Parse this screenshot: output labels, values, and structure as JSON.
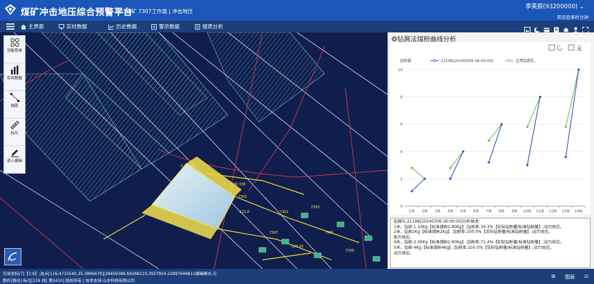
{
  "header": {
    "title": "煤矿冲击地压综合预警平台",
    "mine_info": "唐口煤矿 7307工作面 | 冲击地压",
    "user_name": "李英辰(93200000)",
    "user_sub": "距后登录时分钟",
    "logo_icon": "mine-logo-icon"
  },
  "nav": {
    "items": [
      {
        "label": "主界面",
        "icon": "home-icon"
      },
      {
        "label": "实时数据",
        "icon": "monitor-icon"
      },
      {
        "label": "历史数据",
        "icon": "history-chart-icon"
      },
      {
        "label": "警示数据",
        "icon": "warning-data-icon"
      },
      {
        "label": "报表分析",
        "icon": "report-icon"
      }
    ],
    "right_icons": [
      "image-icon",
      "moon-icon",
      "card-icon",
      "list-icon",
      "bell-icon",
      "person-icon",
      "expand-icon"
    ]
  },
  "map": {
    "tools": [
      {
        "label": "功能菜单",
        "icon": "function-menu-icon"
      },
      {
        "label": "实时数据",
        "icon": "bar-chart-icon"
      },
      {
        "label": "抽层",
        "icon": "layer-icon"
      },
      {
        "label": "标尺",
        "icon": "ruler-icon"
      },
      {
        "label": "进入编辑",
        "icon": "edit-icon"
      }
    ],
    "widget_icon": "map-widget-icon",
    "labels": [
      "7301",
      "7302",
      "-130.338",
      "7303",
      "7305",
      "-121.8",
      "-123.43",
      "7307",
      "-2.4:-96",
      "7309"
    ]
  },
  "panel": {
    "title": "❂钻屑法煤粉曲线分析",
    "toolbar_icons": [
      "restore-icon",
      "refresh-icon",
      "save-icon",
      "download-icon"
    ],
    "analysis": {
      "heading": "钻屑孔,21198[20240306 06:00:00]分析描述:",
      "lines": [
        "1米，钻粉:1.10Kg【标准煤粉2.80Kg】;钻粉率:39.3%【实际钻粉量/标准钻粉量】;动力效应。",
        "2米，钻粉2Kg【标准煤粉2Kg】;钻粉率:100.0%【实际钻粉量/标准钻粉量】;动力效应。",
        "助力效应。",
        "4米，钻粉:2.00Kg【标准煤粉2.80Kg】;钻粉率:71.4%【实际钻粉量/标准钻粉量】;动力效应。",
        "5米，钻粉:4Kg【标准煤粉4Kg】;钻粉率:100.0%【实际钻粉量/标准钻粉量】;动力效应。",
        "动力效应。"
      ]
    }
  },
  "status": {
    "line1": "引用坐标[7]【1:6】;选点[116.4715540,35.3896678]|39459388.69268219,3937954.22897646811编辑模式:无",
    "line2": "图件[路径] 标注[216 线] 第3410] 版权所有 | 技术支持:山东科技有限公司",
    "right": [
      "⊞",
      "图层",
      "⊡"
    ]
  },
  "chart_data": {
    "type": "line",
    "ylabel": "钻粉量",
    "x_ticks": [
      "1米",
      "2米",
      "3米",
      "4米",
      "5米",
      "6米",
      "7米",
      "8米",
      "9米",
      "10米",
      "11米",
      "12米",
      "13米",
      "14米"
    ],
    "ylim": [
      0,
      10
    ],
    "y_ticks": [
      0,
      2,
      4,
      6,
      8,
      10
    ],
    "grid": true,
    "legend_position": "top",
    "series": [
      {
        "name": "21198[20240306 06:00:00]",
        "color": "#3352b8",
        "segments": [
          [
            [
              1,
              1.1
            ],
            [
              2,
              2.0
            ]
          ],
          [
            [
              4,
              2.0
            ],
            [
              5,
              4.0
            ]
          ],
          [
            [
              7,
              3.2
            ],
            [
              8,
              6.0
            ]
          ],
          [
            [
              10,
              3.0
            ],
            [
              11,
              8.0
            ]
          ],
          [
            [
              13,
              3.6
            ],
            [
              14,
              10.0
            ]
          ]
        ]
      },
      {
        "name": "正常钻屑孔",
        "color": "#6fc04a",
        "segments": [
          [
            [
              1,
              2.8
            ],
            [
              2,
              2.0
            ]
          ],
          [
            [
              4,
              2.8
            ],
            [
              5,
              4.0
            ]
          ],
          [
            [
              7,
              4.8
            ],
            [
              8,
              6.0
            ]
          ],
          [
            [
              10,
              5.8
            ],
            [
              11,
              8.0
            ]
          ],
          [
            [
              13,
              5.8
            ],
            [
              14,
              10.0
            ]
          ]
        ]
      }
    ]
  }
}
